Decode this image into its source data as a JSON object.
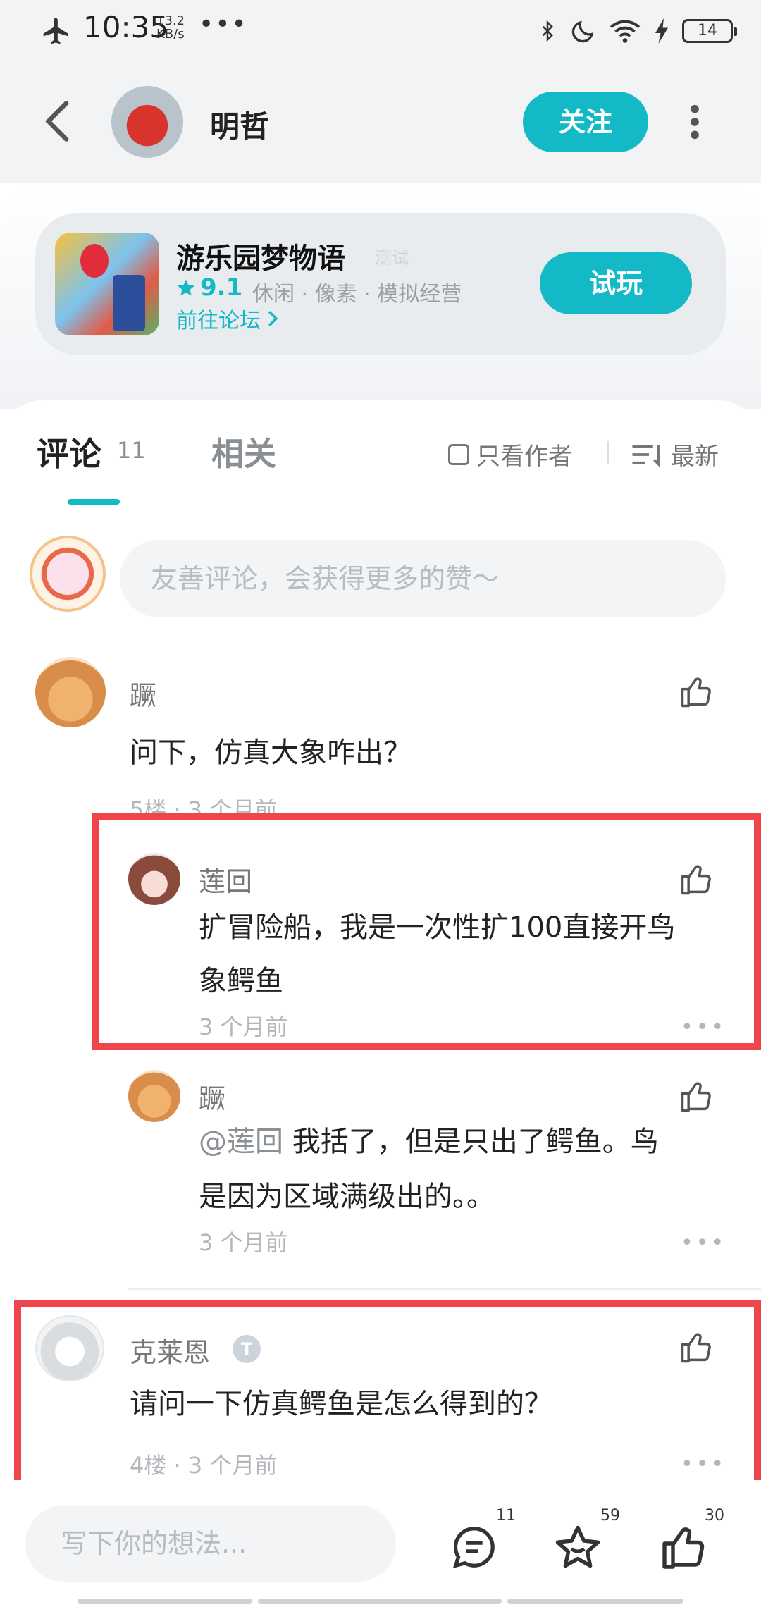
{
  "status_bar": {
    "time": "10:35",
    "speed_value": "13.2",
    "speed_unit": "KB/s",
    "dots": "•••",
    "battery": "14"
  },
  "header": {
    "user_name": "明哲",
    "follow_label": "关注"
  },
  "game": {
    "title": "游乐园梦物语",
    "faint_tag": "测试",
    "rating": "9.1",
    "genres": "休闲 · 像素 · 模拟经营",
    "forum_link": "前往论坛",
    "try_label": "试玩"
  },
  "tabs": {
    "comments_label": "评论",
    "comments_count": "11",
    "related_label": "相关",
    "author_only": "只看作者",
    "sort_label": "最新"
  },
  "comment_input": {
    "placeholder": "友善评论，会获得更多的赞～"
  },
  "comments": [
    {
      "name": "蹶",
      "text": "问下，仿真大象咋出？",
      "meta": "5楼 · 3 个月前",
      "replies": [
        {
          "name": "莲回",
          "line1": "扩冒险船，我是一次性扩100直接开鸟",
          "line2": "象鳄鱼",
          "meta": "3 个月前"
        },
        {
          "name": "蹶",
          "mention": "@莲回",
          "line1": "我括了，但是只出了鳄鱼。鸟",
          "line2": "是因为区域满级出的。。",
          "meta": "3 个月前"
        }
      ]
    },
    {
      "name": "克莱恩",
      "badge": "T",
      "text": "请问一下仿真鳄鱼是怎么得到的？",
      "meta": "4楼 · 3 个月前"
    }
  ],
  "more_dots": "•••",
  "bottom_bar": {
    "placeholder": "写下你的想法...",
    "comment_count": "11",
    "favorite_count": "59",
    "like_count": "30"
  },
  "colors": {
    "accent": "#14b9c8",
    "highlight": "#f0454c"
  }
}
